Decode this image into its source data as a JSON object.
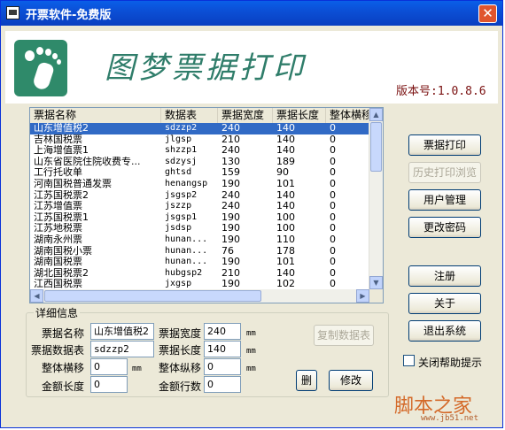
{
  "window": {
    "title": "开票软件-免费版",
    "close_symbol": "✕",
    "banner_text": "图梦票据打印",
    "version": "版本号:1.0.8.6"
  },
  "list": {
    "columns": [
      "票据名称",
      "数据表",
      "票据宽度",
      "票据长度",
      "整体横移"
    ],
    "rows": [
      {
        "name": "山东增值税2",
        "table": "sdzzp2",
        "width": "240",
        "length": "140",
        "shift": "0",
        "selected": true
      },
      {
        "name": "吉林国税票",
        "table": "jlgsp",
        "width": "210",
        "length": "140",
        "shift": "0"
      },
      {
        "name": "上海增值票1",
        "table": "shzzp1",
        "width": "240",
        "length": "140",
        "shift": "0"
      },
      {
        "name": "山东省医院住院收费专...",
        "table": "sdzysj",
        "width": "130",
        "length": "189",
        "shift": "0"
      },
      {
        "name": "工行托收单",
        "table": "ghtsd",
        "width": "159",
        "length": "90",
        "shift": "0"
      },
      {
        "name": "河南国税普通发票",
        "table": "henangsp",
        "width": "190",
        "length": "101",
        "shift": "0"
      },
      {
        "name": "江苏国税票2",
        "table": "jsgsp2",
        "width": "240",
        "length": "140",
        "shift": "0"
      },
      {
        "name": "江苏增值票",
        "table": "jszzp",
        "width": "240",
        "length": "140",
        "shift": "0"
      },
      {
        "name": "江苏国税票1",
        "table": "jsgsp1",
        "width": "190",
        "length": "100",
        "shift": "0"
      },
      {
        "name": "江苏地税票",
        "table": "jsdsp",
        "width": "190",
        "length": "100",
        "shift": "0"
      },
      {
        "name": "湖南永州票",
        "table": "hunan...",
        "width": "190",
        "length": "110",
        "shift": "0"
      },
      {
        "name": "湖南国税小票",
        "table": "hunan...",
        "width": "76",
        "length": "178",
        "shift": "0"
      },
      {
        "name": "湖南国税票",
        "table": "hunan...",
        "width": "190",
        "length": "101",
        "shift": "0"
      },
      {
        "name": "湖北国税票2",
        "table": "hubgsp2",
        "width": "210",
        "length": "140",
        "shift": "0"
      },
      {
        "name": "江西国税票",
        "table": "jxgsp",
        "width": "190",
        "length": "102",
        "shift": "0"
      }
    ]
  },
  "details": {
    "legend": "详细信息",
    "labels": {
      "name": "票据名称",
      "width": "票据宽度",
      "table": "票据数据表",
      "length": "票据长度",
      "hshift": "整体横移",
      "vshift": "整体纵移",
      "amount_len": "金额长度",
      "amount_rows": "金额行数"
    },
    "values": {
      "name": "山东增值税2",
      "width": "240",
      "table": "sdzzp2",
      "length": "140",
      "hshift": "0",
      "vshift": "0",
      "amount_len": "0",
      "amount_rows": "0"
    },
    "unit": "mm",
    "copy_table_button": "复制数据表",
    "delete_button": "删",
    "modify_button": "修改"
  },
  "side_buttons": {
    "print": "票据打印",
    "history": "历史打印浏览",
    "users": "用户管理",
    "password": "更改密码",
    "logout": "注册",
    "about": "关于",
    "exit": "退出系统"
  },
  "help_checkbox": "关闭帮助提示",
  "watermark": {
    "main": "脚本之家",
    "sub": "www.jb51.net"
  }
}
